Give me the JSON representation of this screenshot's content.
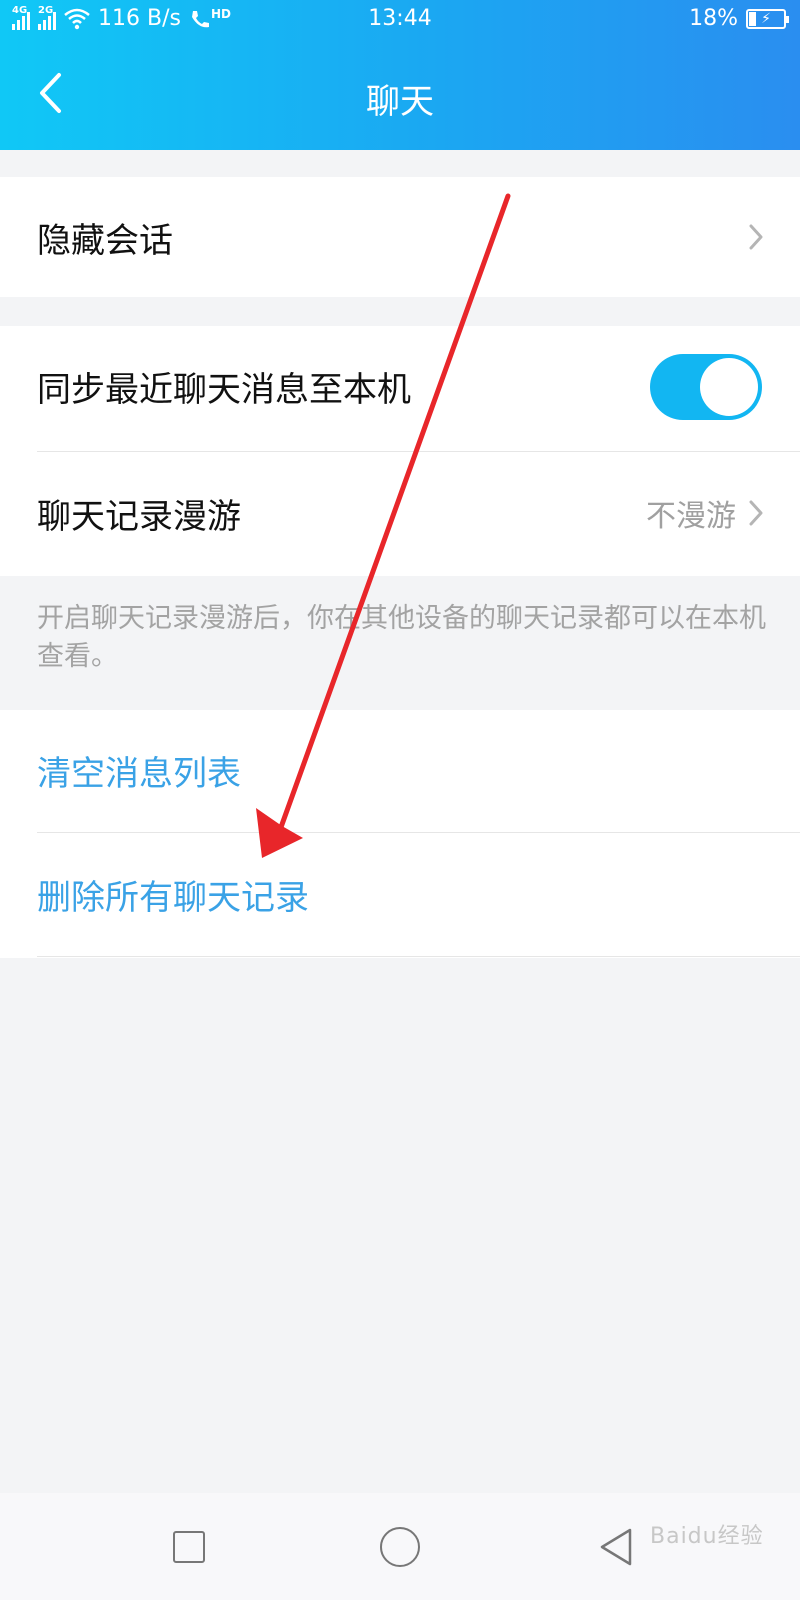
{
  "status_bar": {
    "network_1": "4G",
    "network_2": "2G",
    "speed": "116 B/s",
    "call_badge": "HD",
    "time": "13:44",
    "battery_percent": "18%"
  },
  "header": {
    "title": "聊天"
  },
  "settings": {
    "hide_sessions": {
      "label": "隐藏会话"
    },
    "sync_recent": {
      "label": "同步最近聊天消息至本机",
      "enabled": true
    },
    "roaming": {
      "label": "聊天记录漫游",
      "value": "不漫游"
    },
    "roaming_hint": "开启聊天记录漫游后，你在其他设备的聊天记录都可以在本机查看。",
    "clear_list": {
      "label": "清空消息列表"
    },
    "delete_all": {
      "label": "删除所有聊天记录"
    }
  },
  "colors": {
    "header_gradient_start": "#10c8f6",
    "header_gradient_end": "#2a8ef0",
    "toggle_on": "#12b6f2",
    "link_blue": "#3aa2e6",
    "annotation_arrow": "#e8262a"
  },
  "watermark": "Baidu经验"
}
